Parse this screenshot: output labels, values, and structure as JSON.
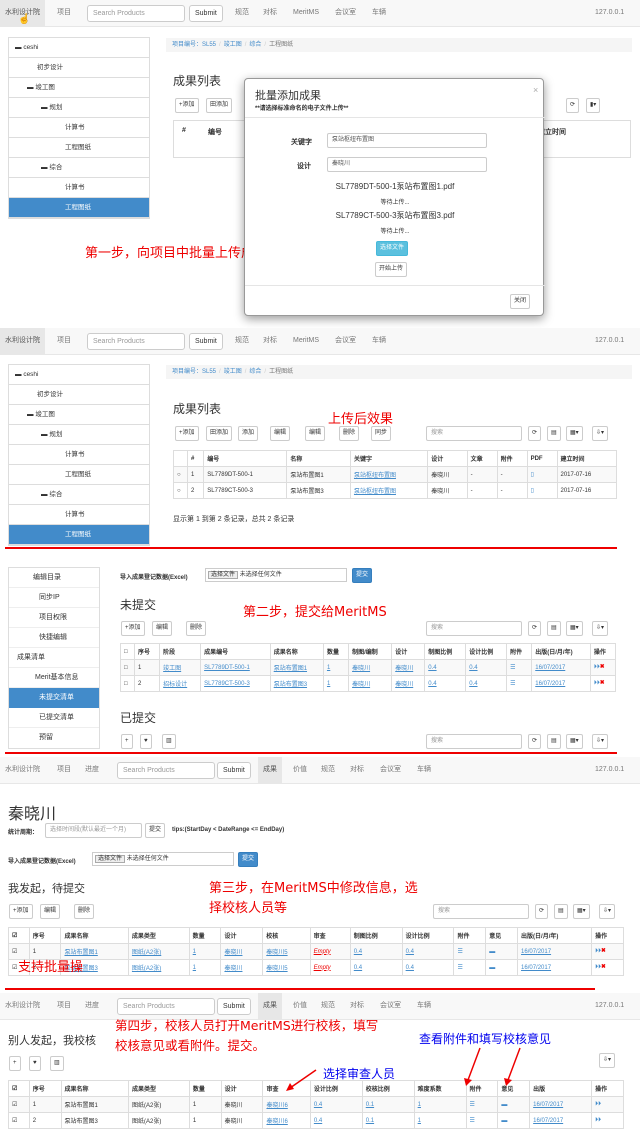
{
  "nav": {
    "brand": "水利设计院",
    "project": "项目",
    "progress": "进度",
    "search_placeholder": "Search Products",
    "submit": "Submit",
    "results": "成果",
    "price": "价值",
    "spec": "规范",
    "benchmark": "对标",
    "meritms": "MeritMS",
    "meeting": "会议室",
    "vehicle": "车辆",
    "ip": "127.0.0.1"
  },
  "tree": {
    "root": "ceshi",
    "n1": "初步设计",
    "n2": "竣工图",
    "n3": "规划",
    "n4": "计算书",
    "n5": "工程图纸",
    "n6": "综合",
    "n7": "计算书",
    "n8": "工程图纸"
  },
  "crumb": {
    "c1": "项目编号：SL55",
    "c2": "竣工图",
    "c3": "综合",
    "c4": "工程图纸"
  },
  "s1": {
    "title": "成果列表",
    "add": "+添加",
    "batch": "田添加",
    "hash": "#",
    "num": "编号",
    "time": "建立时间"
  },
  "modal": {
    "title": "批量添加成果",
    "subtitle": "**请选择标准命名的电子文件上传**",
    "close": "×",
    "kw_label": "关键字",
    "kw_value": "泵站枢纽布置图",
    "des_label": "设计",
    "des_value": "秦晓川",
    "file1": "SL7789DT-500-1泵站布置图1.pdf",
    "wait1": "等待上传...",
    "file2": "SL7789CT-500-3泵站布置图3.pdf",
    "wait2": "等待上传...",
    "choose": "选择文件",
    "upload": "开始上传",
    "close_btn": "关闭"
  },
  "ann": {
    "a1": "第一步，向项目中批量上传成果",
    "a2": "上传后效果",
    "a3": "第二步，提交给MeritMS",
    "a4": "第三步，在MeritMS中修改信息，选择校核人员等",
    "a5": "支持批量操",
    "a6": "第四步，校核人员打开MeritMS进行校核，填写校核意见或看附件。提交。",
    "a7": "选择审查人员",
    "a8": "查看附件和填写校核意见"
  },
  "s2": {
    "title": "成果列表",
    "tb": [
      "+添加",
      "田添加",
      "添加",
      "编辑",
      "编辑",
      "删除",
      "同步"
    ],
    "search": "搜索",
    "headers": [
      "#",
      "编号",
      "名称",
      "关键字",
      "设计",
      "文章",
      "附件",
      "PDF",
      "建立时间"
    ],
    "rows": [
      [
        "1",
        "SL7789DT-500-1",
        "泵站布置图1",
        "泵站枢纽布置图",
        "秦晓川",
        "-",
        "-",
        "",
        "2017-07-16"
      ],
      [
        "2",
        "SL7789CT-500-3",
        "泵站布置图3",
        "泵站枢纽布置图",
        "秦晓川",
        "-",
        "-",
        "",
        "2017-07-16"
      ]
    ],
    "footer": "显示第 1 到第 2 条记录，总共 2 条记录"
  },
  "s3": {
    "menu": [
      "编辑目录",
      "同步IP",
      "项目权限",
      "快捷编辑",
      "成果清单",
      "Merit基本信息",
      "未提交清单",
      "已提交清单",
      "预留"
    ],
    "import_label": "导入成果登记数据(Excel)",
    "choose": "选择文件",
    "nofile": "未选择任何文件",
    "submit": "提交",
    "unsub": "未提交",
    "sub": "已提交",
    "tb": [
      "+添加",
      "编辑",
      "删除"
    ],
    "search": "搜索",
    "headers": [
      "序号",
      "阶段",
      "成果编号",
      "成果名称",
      "数量",
      "制图/编制",
      "设计",
      "制图比例",
      "设计比例",
      "附件",
      "出版(日/月/年)",
      "操作"
    ],
    "rows": [
      [
        "1",
        "竣工图",
        "SL7789DT-500-1",
        "泵站布置图1",
        "1",
        "秦晓川",
        "秦晓川",
        "0.4",
        "0.4",
        "",
        "16/07/2017"
      ],
      [
        "2",
        "招标设计",
        "SL7789CT-500-3",
        "泵站布置图3",
        "1",
        "秦晓川",
        "秦晓川",
        "0.4",
        "0.4",
        "",
        "16/07/2017"
      ]
    ]
  },
  "s4": {
    "name": "秦晓川",
    "stat_label": "统计周期：",
    "stat_placeholder": "选择时间段(默认最近一个月)",
    "submit": "提交",
    "tip": "tips:(StartDay < DateRange <= EndDay)",
    "import_label": "导入成果登记数据(Excel)",
    "choose": "选择文件",
    "nofile": "未选择任何文件",
    "title": "我发起，待提交",
    "tb": [
      "+添加",
      "编辑",
      "删除"
    ],
    "search": "搜索",
    "headers": [
      "序号",
      "成果名称",
      "成果类型",
      "数量",
      "设计",
      "校核",
      "审查",
      "制图比例",
      "设计比例",
      "附件",
      "意见",
      "出版(日/月/年)",
      "操作"
    ],
    "rows": [
      [
        "1",
        "泵站布置图1",
        "图纸(A2张)",
        "1",
        "秦晓川",
        "秦晓川5",
        "Empty",
        "0.4",
        "0.4",
        "",
        "",
        "16/07/2017"
      ],
      [
        "2",
        "泵站布置图3",
        "图纸(A2张)",
        "1",
        "秦晓川",
        "秦晓川5",
        "Empty",
        "0.4",
        "0.4",
        "",
        "",
        "16/07/2017"
      ]
    ]
  },
  "s5": {
    "title": "别人发起，我校核",
    "headers": [
      "序号",
      "成果名称",
      "成果类型",
      "数量",
      "设计",
      "审查",
      "设计比例",
      "校核比例",
      "难度系数",
      "附件",
      "意见",
      "出版",
      "操作"
    ],
    "rows": [
      [
        "1",
        "泵站布置图1",
        "图纸(A2张)",
        "1",
        "秦晓川",
        "秦晓川6",
        "0.4",
        "0.1",
        "1",
        "",
        "",
        "16/07/2017"
      ],
      [
        "2",
        "泵站布置图3",
        "图纸(A2张)",
        "1",
        "秦晓川",
        "秦晓川6",
        "0.4",
        "0.1",
        "1",
        "",
        "",
        "16/07/2017"
      ]
    ]
  }
}
